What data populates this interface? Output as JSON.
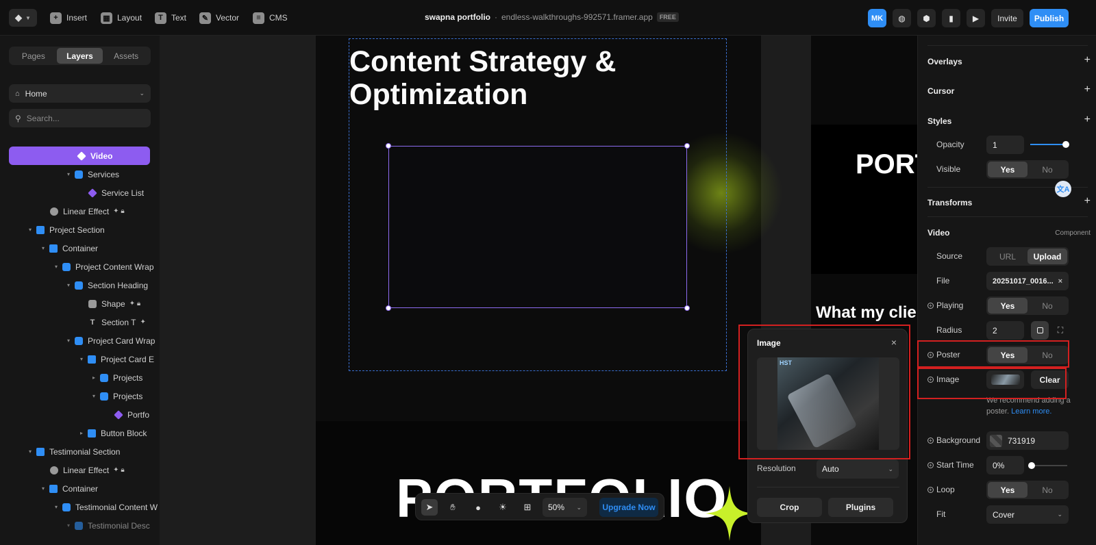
{
  "topbar": {
    "insert": "Insert",
    "layout": "Layout",
    "text": "Text",
    "vector": "Vector",
    "cms": "CMS",
    "project_name": "swapna portfolio",
    "separator": "·",
    "project_url": "endless-walkthroughs-992571.framer.app",
    "plan_badge": "FREE",
    "avatar_initials": "MK",
    "invite": "Invite",
    "publish": "Publish"
  },
  "left": {
    "tabs": [
      "Pages",
      "Layers",
      "Assets"
    ],
    "page_select": "Home",
    "search_placeholder": "Search...",
    "layers": [
      {
        "label": "Video",
        "icon": "component-icon"
      },
      {
        "label": "Services",
        "icon": "stack-icon"
      },
      {
        "label": "Service List",
        "icon": "component-icon"
      },
      {
        "label": "Linear Effect",
        "icon": "circle-icon"
      },
      {
        "label": "Project Section",
        "icon": "grid-icon"
      },
      {
        "label": "Container",
        "icon": "grid-icon"
      },
      {
        "label": "Project Content Wrap",
        "icon": "stack-icon"
      },
      {
        "label": "Section Heading",
        "icon": "stack-icon"
      },
      {
        "label": "Shape",
        "icon": "image-icon"
      },
      {
        "label": "Section T",
        "icon": "text-icon"
      },
      {
        "label": "Project Card Wrap",
        "icon": "stack-icon"
      },
      {
        "label": "Project Card E",
        "icon": "grid-icon"
      },
      {
        "label": "Projects",
        "icon": "stack-icon"
      },
      {
        "label": "Projects",
        "icon": "stack-icon"
      },
      {
        "label": "Portfo",
        "icon": "component-icon"
      },
      {
        "label": "Button Block",
        "icon": "grid-icon"
      },
      {
        "label": "Testimonial Section",
        "icon": "grid-icon"
      },
      {
        "label": "Linear Effect",
        "icon": "circle-icon"
      },
      {
        "label": "Container",
        "icon": "grid-icon"
      },
      {
        "label": "Testimonial Content W",
        "icon": "stack-icon"
      },
      {
        "label": "Testimonial Desc",
        "icon": "stack-icon"
      }
    ]
  },
  "canvas": {
    "heading": "Content Strategy & Optimization",
    "portfolio_text": "PORTFOLIO",
    "port_text": "PORT",
    "what_text": "What my clie"
  },
  "toolbar": {
    "zoom": "50%",
    "upgrade": "Upgrade Now"
  },
  "popup": {
    "title": "Image",
    "close": "×",
    "thumb_caption": "HST",
    "resolution_label": "Resolution",
    "resolution_value": "Auto",
    "crop": "Crop",
    "plugins": "Plugins"
  },
  "right": {
    "overlays": "Overlays",
    "cursor": "Cursor",
    "styles": "Styles",
    "opacity_label": "Opacity",
    "opacity_value": "1",
    "opacity_level": 1.0,
    "visible_label": "Visible",
    "yes": "Yes",
    "no": "No",
    "transforms": "Transforms",
    "video": "Video",
    "component": "Component",
    "source_label": "Source",
    "url": "URL",
    "upload": "Upload",
    "file_label": "File",
    "file_value": "20251017_0016...",
    "playing_label": "Playing",
    "radius_label": "Radius",
    "radius_value": "2",
    "poster_label": "Poster",
    "image_label": "Image",
    "clear": "Clear",
    "recommend": "We recommend adding a poster.",
    "learn_more": "Learn more.",
    "background_label": "Background",
    "background_value": "731919",
    "start_label": "Start Time",
    "start_value": "0%",
    "start_level": 0.0,
    "loop_label": "Loop",
    "fit_label": "Fit",
    "fit_value": "Cover"
  },
  "colors": {
    "accent_blue": "#2f8ef5",
    "selection_purple": "#8d5cf0",
    "highlight_red": "#d42020",
    "glow_lime": "#c8f02a"
  }
}
